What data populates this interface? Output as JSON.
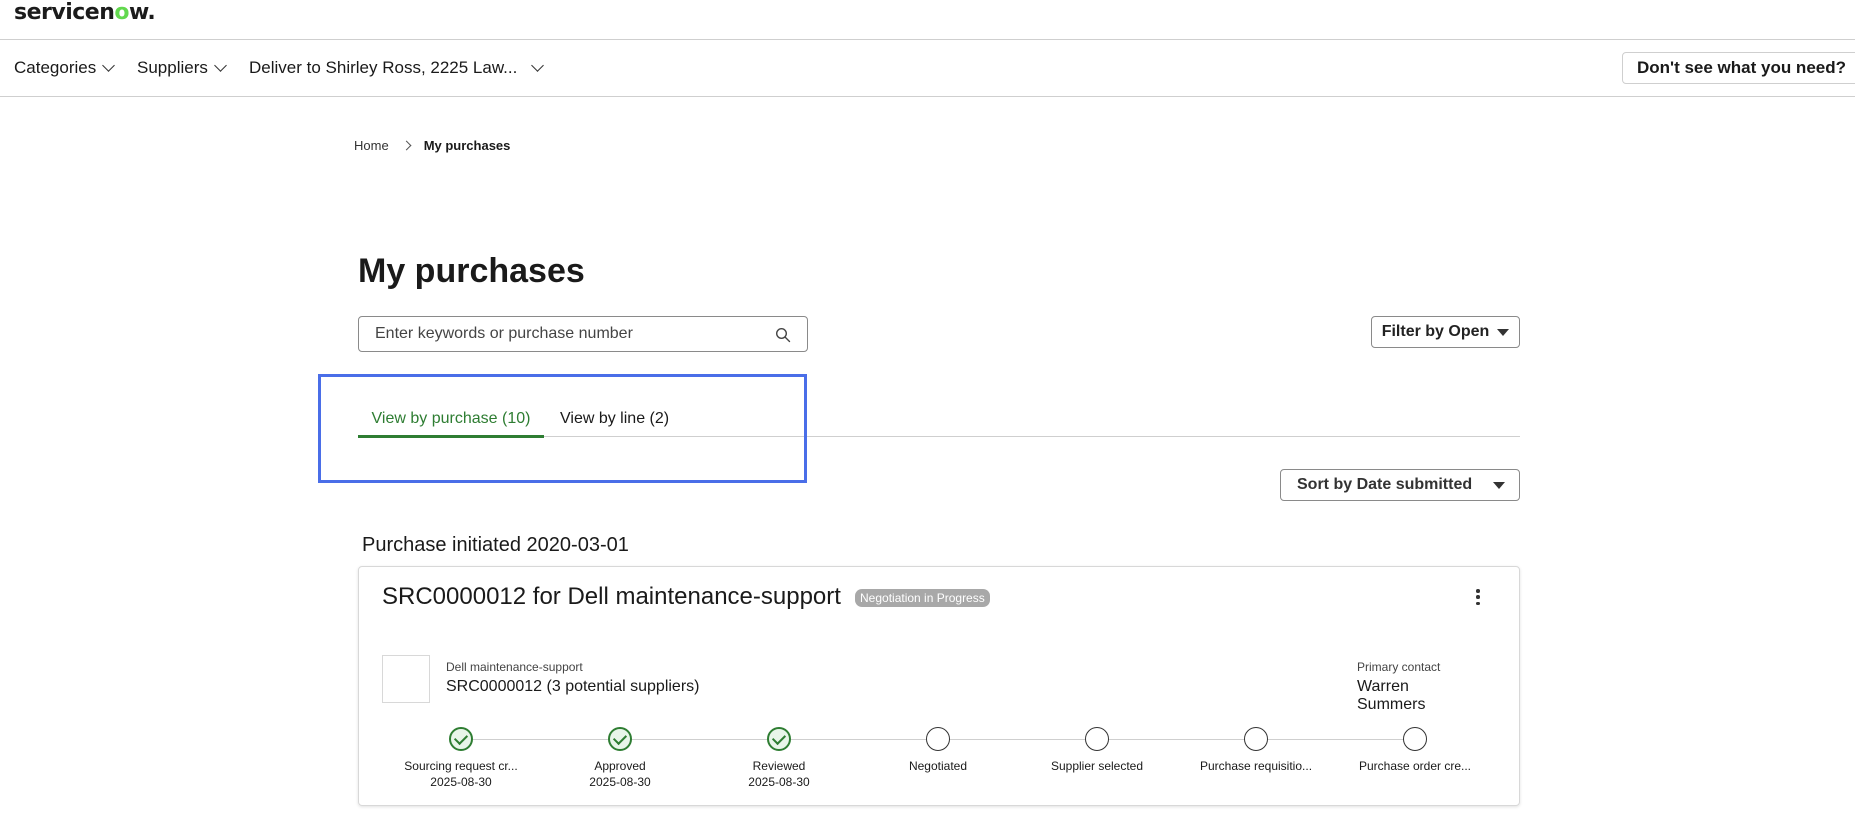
{
  "app": {
    "logo_prefix": "servicen",
    "logo_o": "o",
    "logo_suffix": "w",
    "logo_dot": "."
  },
  "nav": {
    "categories": "Categories",
    "suppliers": "Suppliers",
    "deliver_to": "Deliver to Shirley Ross, 2225 Law...",
    "help_button": "Don't see what you need?"
  },
  "breadcrumb": {
    "home": "Home",
    "current": "My purchases"
  },
  "page": {
    "title": "My purchases"
  },
  "search": {
    "placeholder": "Enter keywords or purchase number",
    "value": ""
  },
  "filter": {
    "label": "Filter by Open"
  },
  "tabs": [
    {
      "label": "View by purchase (10)",
      "active": true
    },
    {
      "label": "View by line (2)",
      "active": false
    }
  ],
  "sort": {
    "label": "Sort by Date submitted"
  },
  "groups": [
    {
      "heading": "Purchase initiated 2020-03-01",
      "card": {
        "title": "SRC0000012 for Dell maintenance-support",
        "status": "Negotiation in Progress",
        "item_sub": "Dell maintenance-support",
        "item_main": "SRC0000012 (3 potential suppliers)",
        "contact_label": "Primary contact",
        "contact_name": "Warren Summers",
        "steps": [
          {
            "label": "Sourcing request cr...",
            "date": "2025-08-30",
            "done": true
          },
          {
            "label": "Approved",
            "date": "2025-08-30",
            "done": true
          },
          {
            "label": "Reviewed",
            "date": "2025-08-30",
            "done": true
          },
          {
            "label": "Negotiated",
            "date": "",
            "done": false
          },
          {
            "label": "Supplier selected",
            "date": "",
            "done": false
          },
          {
            "label": "Purchase requisitio...",
            "date": "",
            "done": false
          },
          {
            "label": "Purchase order cre...",
            "date": "",
            "done": false
          }
        ]
      }
    }
  ],
  "colors": {
    "accent": "#2e7d32",
    "logo_green": "#62d84e",
    "highlight": "#4a6ee8",
    "badge": "#a8a8a8"
  }
}
